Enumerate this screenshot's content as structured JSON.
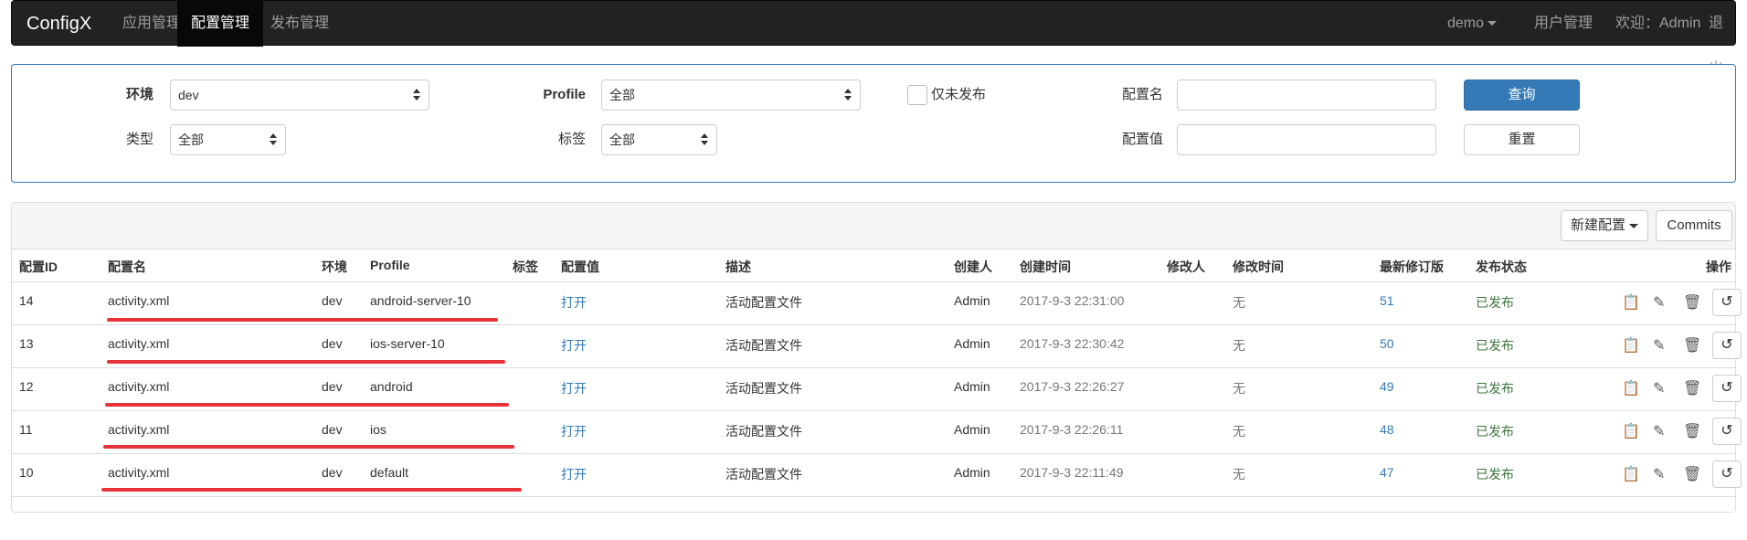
{
  "navbar": {
    "brand": "ConfigX",
    "nav": [
      "应用管理",
      "配置管理",
      "发布管理"
    ],
    "right": {
      "app_switch": "demo",
      "users": "用户管理",
      "welcome": "欢迎：Admin",
      "logout": "退出"
    }
  },
  "filters": {
    "env_label": "环境",
    "env_value": "dev",
    "profile_label": "Profile",
    "profile_value": "全部",
    "unpublished_only_label": "仅未发布",
    "config_name_label": "配置名",
    "config_name_value": "",
    "query_button": "查询",
    "type_label": "类型",
    "type_value": "全部",
    "tag_label": "标签",
    "tag_value": "全部",
    "config_value_label": "配置值",
    "config_value_value": "",
    "reset_button": "重置"
  },
  "toolbar": {
    "new_config": "新建配置",
    "commits": "Commits"
  },
  "table": {
    "headers": [
      "配置ID",
      "配置名",
      "环境",
      "Profile",
      "标签",
      "配置值",
      "描述",
      "创建人",
      "创建时间",
      "修改人",
      "修改时间",
      "最新修订版",
      "发布状态",
      "操作"
    ],
    "rows": [
      {
        "id": "14",
        "name": "activity.xml",
        "env": "dev",
        "profile": "android-server-10",
        "tag": "",
        "value": "打开",
        "desc": "活动配置文件",
        "creator": "Admin",
        "created": "2017-9-3 22:31:00",
        "modifier": "",
        "modified": "无",
        "revision": "51",
        "status": "已发布"
      },
      {
        "id": "13",
        "name": "activity.xml",
        "env": "dev",
        "profile": "ios-server-10",
        "tag": "",
        "value": "打开",
        "desc": "活动配置文件",
        "creator": "Admin",
        "created": "2017-9-3 22:30:42",
        "modifier": "",
        "modified": "无",
        "revision": "50",
        "status": "已发布"
      },
      {
        "id": "12",
        "name": "activity.xml",
        "env": "dev",
        "profile": "android",
        "tag": "",
        "value": "打开",
        "desc": "活动配置文件",
        "creator": "Admin",
        "created": "2017-9-3 22:26:27",
        "modifier": "",
        "modified": "无",
        "revision": "49",
        "status": "已发布"
      },
      {
        "id": "11",
        "name": "activity.xml",
        "env": "dev",
        "profile": "ios",
        "tag": "",
        "value": "打开",
        "desc": "活动配置文件",
        "creator": "Admin",
        "created": "2017-9-3 22:26:11",
        "modifier": "",
        "modified": "无",
        "revision": "48",
        "status": "已发布"
      },
      {
        "id": "10",
        "name": "activity.xml",
        "env": "dev",
        "profile": "default",
        "tag": "",
        "value": "打开",
        "desc": "活动配置文件",
        "creator": "Admin",
        "created": "2017-9-3 22:11:49",
        "modifier": "",
        "modified": "无",
        "revision": "47",
        "status": "已发布"
      }
    ],
    "row_action_icons": [
      "clipboard-icon",
      "pencil-icon",
      "trash-icon",
      "revert-icon"
    ]
  },
  "colors": {
    "navbar": "#222222",
    "primary": "#337ab7",
    "success": "#3c763d",
    "annotation": "#e8333a"
  }
}
